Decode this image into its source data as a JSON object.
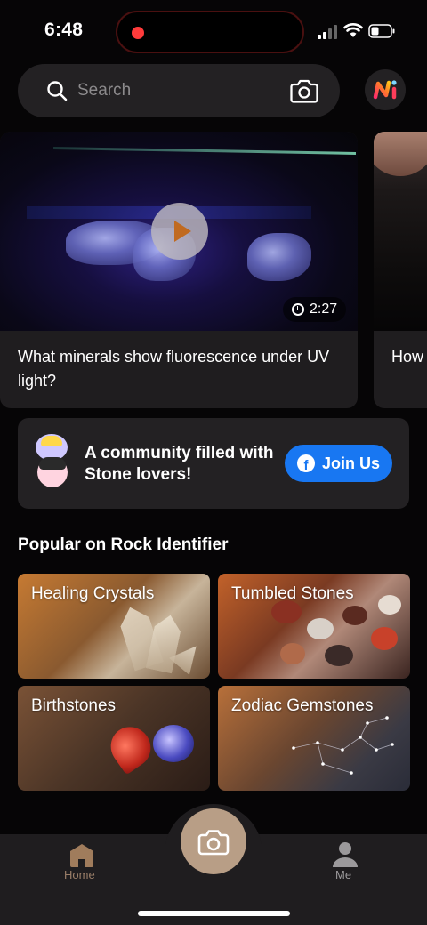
{
  "status_bar": {
    "time": "6:48"
  },
  "search": {
    "placeholder": "Search"
  },
  "videos": [
    {
      "title": "What minerals show fluorescence under UV light?",
      "duration": "2:27"
    },
    {
      "title": "How magn"
    }
  ],
  "community": {
    "text": "A community filled with Stone lovers!",
    "button_label": "Join Us"
  },
  "popular": {
    "title": "Popular on Rock Identifier",
    "tiles": [
      "Healing Crystals",
      "Tumbled Stones",
      "Birthstones",
      "Zodiac Gemstones"
    ]
  },
  "bottom_nav": {
    "home_label": "Home",
    "me_label": "Me"
  },
  "colors": {
    "accent": "#b89e86",
    "facebook": "#1877f2",
    "background": "#060506",
    "card": "#232123"
  }
}
